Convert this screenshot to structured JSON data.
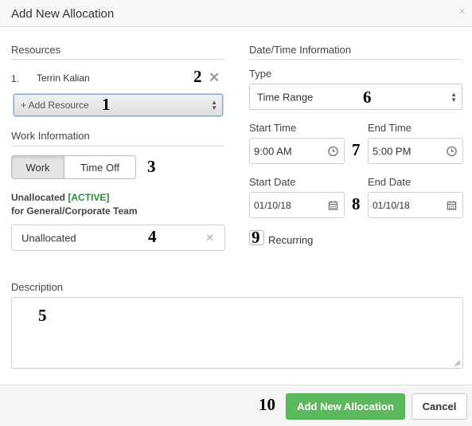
{
  "dialog": {
    "title": "Add New Allocation",
    "close_glyph": "×"
  },
  "resources": {
    "heading": "Resources",
    "items": [
      {
        "number": "1.",
        "name": "Terrin Kalian",
        "remove_glyph": "✕"
      }
    ],
    "add_select": {
      "value": "+ Add Resource"
    }
  },
  "work_info": {
    "heading": "Work Information",
    "toggle": {
      "selected": "Work",
      "options": [
        "Work",
        "Time Off"
      ]
    },
    "team_prefix": "Unallocated ",
    "team_status": "[ACTIVE]",
    "team_suffix": "for General/Corporate Team",
    "allocation_value": "Unallocated",
    "clear_glyph": "✕"
  },
  "datetime": {
    "heading": "Date/Time Information",
    "type_label": "Type",
    "type_value": "Time Range",
    "start_time_label": "Start Time",
    "start_time": "9:00 AM",
    "end_time_label": "End Time",
    "end_time": "5:00 PM",
    "start_date_label": "Start Date",
    "start_date": "01/10/18",
    "end_date_label": "End Date",
    "end_date": "01/10/18",
    "recurring_label": "Recurring",
    "recurring_checked": false
  },
  "description": {
    "label": "Description",
    "value": ""
  },
  "footer": {
    "submit_label": "Add New Allocation",
    "cancel_label": "Cancel"
  },
  "annotations": [
    "1",
    "2",
    "3",
    "4",
    "5",
    "6",
    "7",
    "8",
    "9",
    "10"
  ],
  "colors": {
    "primary_button": "#5cb85c",
    "active_status": "#2e8b3a",
    "focus_border": "#7fa7d8"
  },
  "icons": [
    "close-icon",
    "remove-icon",
    "select-arrows-icon",
    "clock-icon",
    "calendar-icon",
    "clear-icon",
    "resize-grip-icon"
  ]
}
